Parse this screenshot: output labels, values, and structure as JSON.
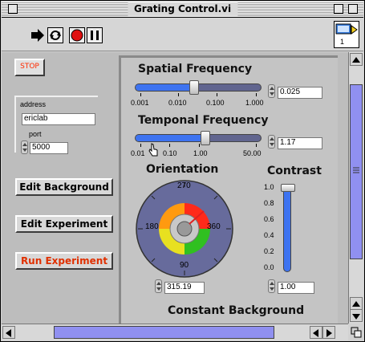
{
  "window": {
    "title": "Grating Control.vi"
  },
  "toolbar": {
    "buttons": [
      "run-arrow-icon",
      "run-continuous-icon",
      "abort-icon",
      "pause-icon"
    ],
    "vi_icon_number": "1"
  },
  "stop_button": {
    "label": "STOP",
    "color": "#ff2a00"
  },
  "address": {
    "label": "address",
    "value": "ericlab"
  },
  "port": {
    "label": "port",
    "value": "5000"
  },
  "actions": [
    {
      "label": "Edit Background",
      "color": "#000000"
    },
    {
      "label": "Edit Experiment",
      "color": "#000000"
    },
    {
      "label": "Run Experiment",
      "color": "#e03000"
    }
  ],
  "spatial_frequency": {
    "title": "Spatial Frequency",
    "ticks": [
      "0.001",
      "0.010",
      "0.100",
      "1.000"
    ],
    "value": "0.025",
    "scale": "log"
  },
  "temporal_frequency": {
    "title": "Temponal Frequency",
    "ticks": [
      "0.01",
      "0.10",
      "1.00",
      "50.00"
    ],
    "value": "1.17",
    "scale": "log"
  },
  "orientation": {
    "title": "Orientation",
    "labels": {
      "top": "270",
      "left": "180",
      "right": "360",
      "bottom": "90"
    },
    "value": "315.19"
  },
  "contrast": {
    "title": "Contrast",
    "ticks": [
      "1.0",
      "0.8",
      "0.6",
      "0.4",
      "0.2",
      "0.0"
    ],
    "value": "1.00",
    "level": 1.0
  },
  "footer_label": "Constant Background",
  "colors": {
    "accent": "#3d73f0",
    "track": "#61658f",
    "scroll_thumb": "#9090f0"
  }
}
